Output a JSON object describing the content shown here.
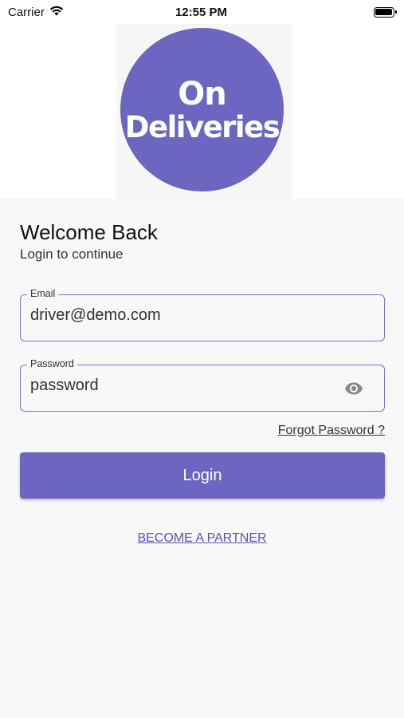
{
  "status_bar": {
    "carrier": "Carrier",
    "time": "12:55 PM"
  },
  "logo": {
    "line1": "On",
    "line2": "Deliveries",
    "color": "#6c66c0"
  },
  "login": {
    "title": "Welcome Back",
    "subtitle": "Login to continue",
    "email_label": "Email",
    "email_value": "driver@demo.com",
    "password_label": "Password",
    "password_value": "password",
    "password_toggle_icon": "eye-icon",
    "forgot_link": "Forgot Password ?",
    "login_button": "Login",
    "partner_link": "BECOME A PARTNER"
  },
  "colors": {
    "accent": "#6c66c0",
    "background": "#f8f8f8"
  }
}
